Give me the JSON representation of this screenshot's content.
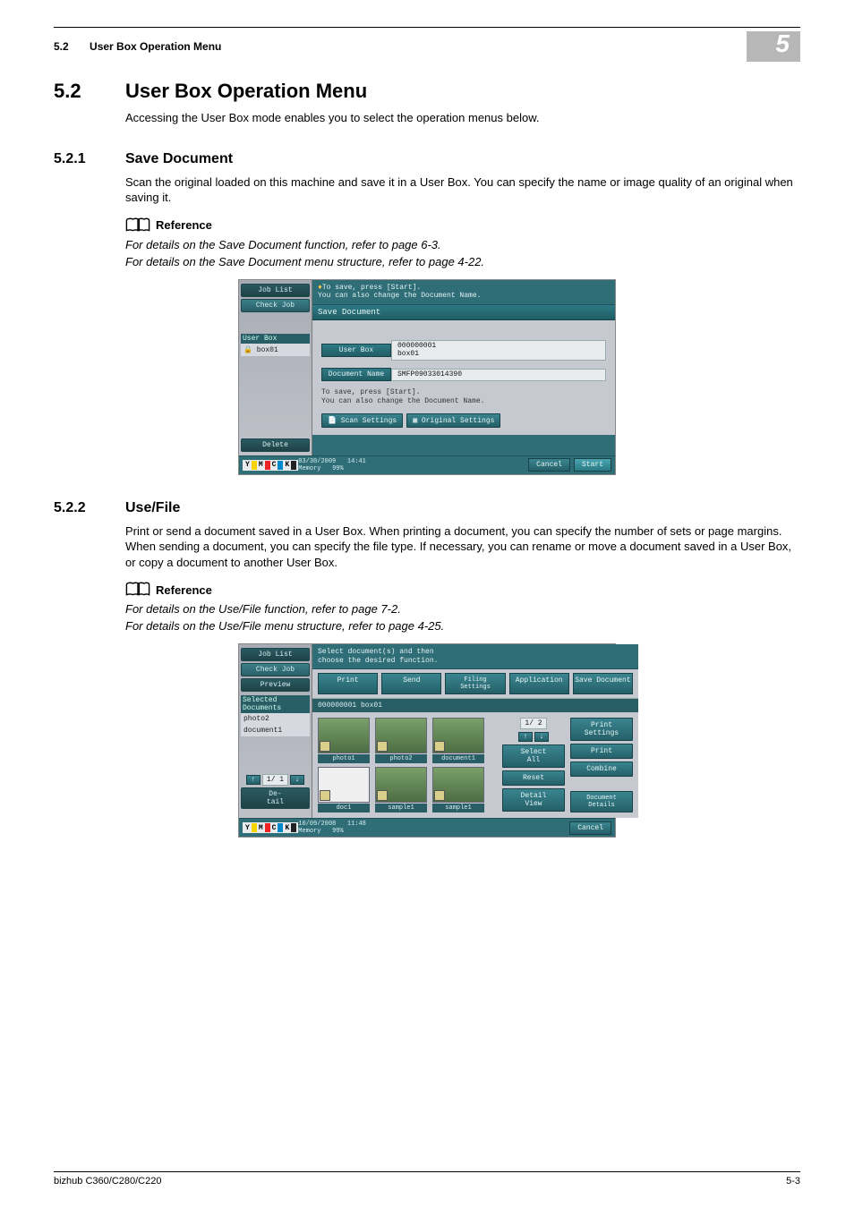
{
  "header": {
    "section_no": "5.2",
    "section_title": "User Box Operation Menu",
    "chapter_badge": "5"
  },
  "h2": {
    "num": "5.2",
    "title": "User Box Operation Menu"
  },
  "intro": "Accessing the User Box mode enables you to select the operation menus below.",
  "s1": {
    "num": "5.2.1",
    "title": "Save Document",
    "body": "Scan the original loaded on this machine and save it in a User Box. You can specify the name or image quality of an original when saving it.",
    "ref_label": "Reference",
    "ref1": "For details on the Save Document function, refer to page 6-3.",
    "ref2": "For details on the Save Document menu structure, refer to page 4-22."
  },
  "ss1": {
    "job_list": "Job List",
    "check_job": "Check Job",
    "user_box_label": "User Box",
    "box_item": "box01",
    "delete": "Delete",
    "top_msg1": "To save, press [Start].",
    "top_msg2": "You can also change the Document Name.",
    "panel_title": "Save Document",
    "field_userbox": "User Box",
    "field_userbox_val1": "000000001",
    "field_userbox_val2": "box01",
    "field_docname": "Document Name",
    "field_docname_val": "SMFP09033014390",
    "note1": "To save, press [Start].",
    "note2": "You can also change the Document Name.",
    "scan_settings": "Scan Settings",
    "orig_settings": "Original Settings",
    "date": "03/30/2009",
    "time": "14:41",
    "mem_label": "Memory",
    "mem_val": "99%",
    "cancel": "Cancel",
    "start": "Start"
  },
  "s2": {
    "num": "5.2.2",
    "title": "Use/File",
    "body": "Print or send a document saved in a User Box. When printing a document, you can specify the number of sets or page margins. When sending a document, you can specify the file type. If necessary, you can rename or move a document saved in a User Box, or copy a document to another User Box.",
    "ref_label": "Reference",
    "ref1": "For details on the Use/File function, refer to page 7-2.",
    "ref2": "For details on the Use/File menu structure, refer to page 4-25."
  },
  "ss2": {
    "job_list": "Job List",
    "check_job": "Check Job",
    "preview": "Preview",
    "selected_docs": "Selected Documents",
    "sel1": "photo2",
    "sel2": "document1",
    "pager_left": "1/  1",
    "detail_btn": "De-\ntail",
    "top_msg1": "Select document(s) and then",
    "top_msg2": "choose the desired function.",
    "tabs": {
      "print": "Print",
      "send": "Send",
      "filing": "Filing\nSettings",
      "app": "Application",
      "save": "Save Document"
    },
    "crumb": "000000001  box01",
    "thumbs": [
      "photo1",
      "photo2",
      "document1",
      "doc1",
      "sample1",
      "sample1"
    ],
    "pager_right": "1/  2",
    "side": {
      "print_settings": "Print Settings",
      "print": "Print",
      "combine": "Combine",
      "select_all": "Select\nAll",
      "reset": "Reset",
      "detail_view": "Detail\nView",
      "doc_details": "Document\nDetails"
    },
    "date": "10/09/2008",
    "time": "11:48",
    "mem_label": "Memory",
    "mem_val": "99%",
    "cancel": "Cancel"
  },
  "footer": {
    "left": "bizhub C360/C280/C220",
    "right": "5-3"
  }
}
